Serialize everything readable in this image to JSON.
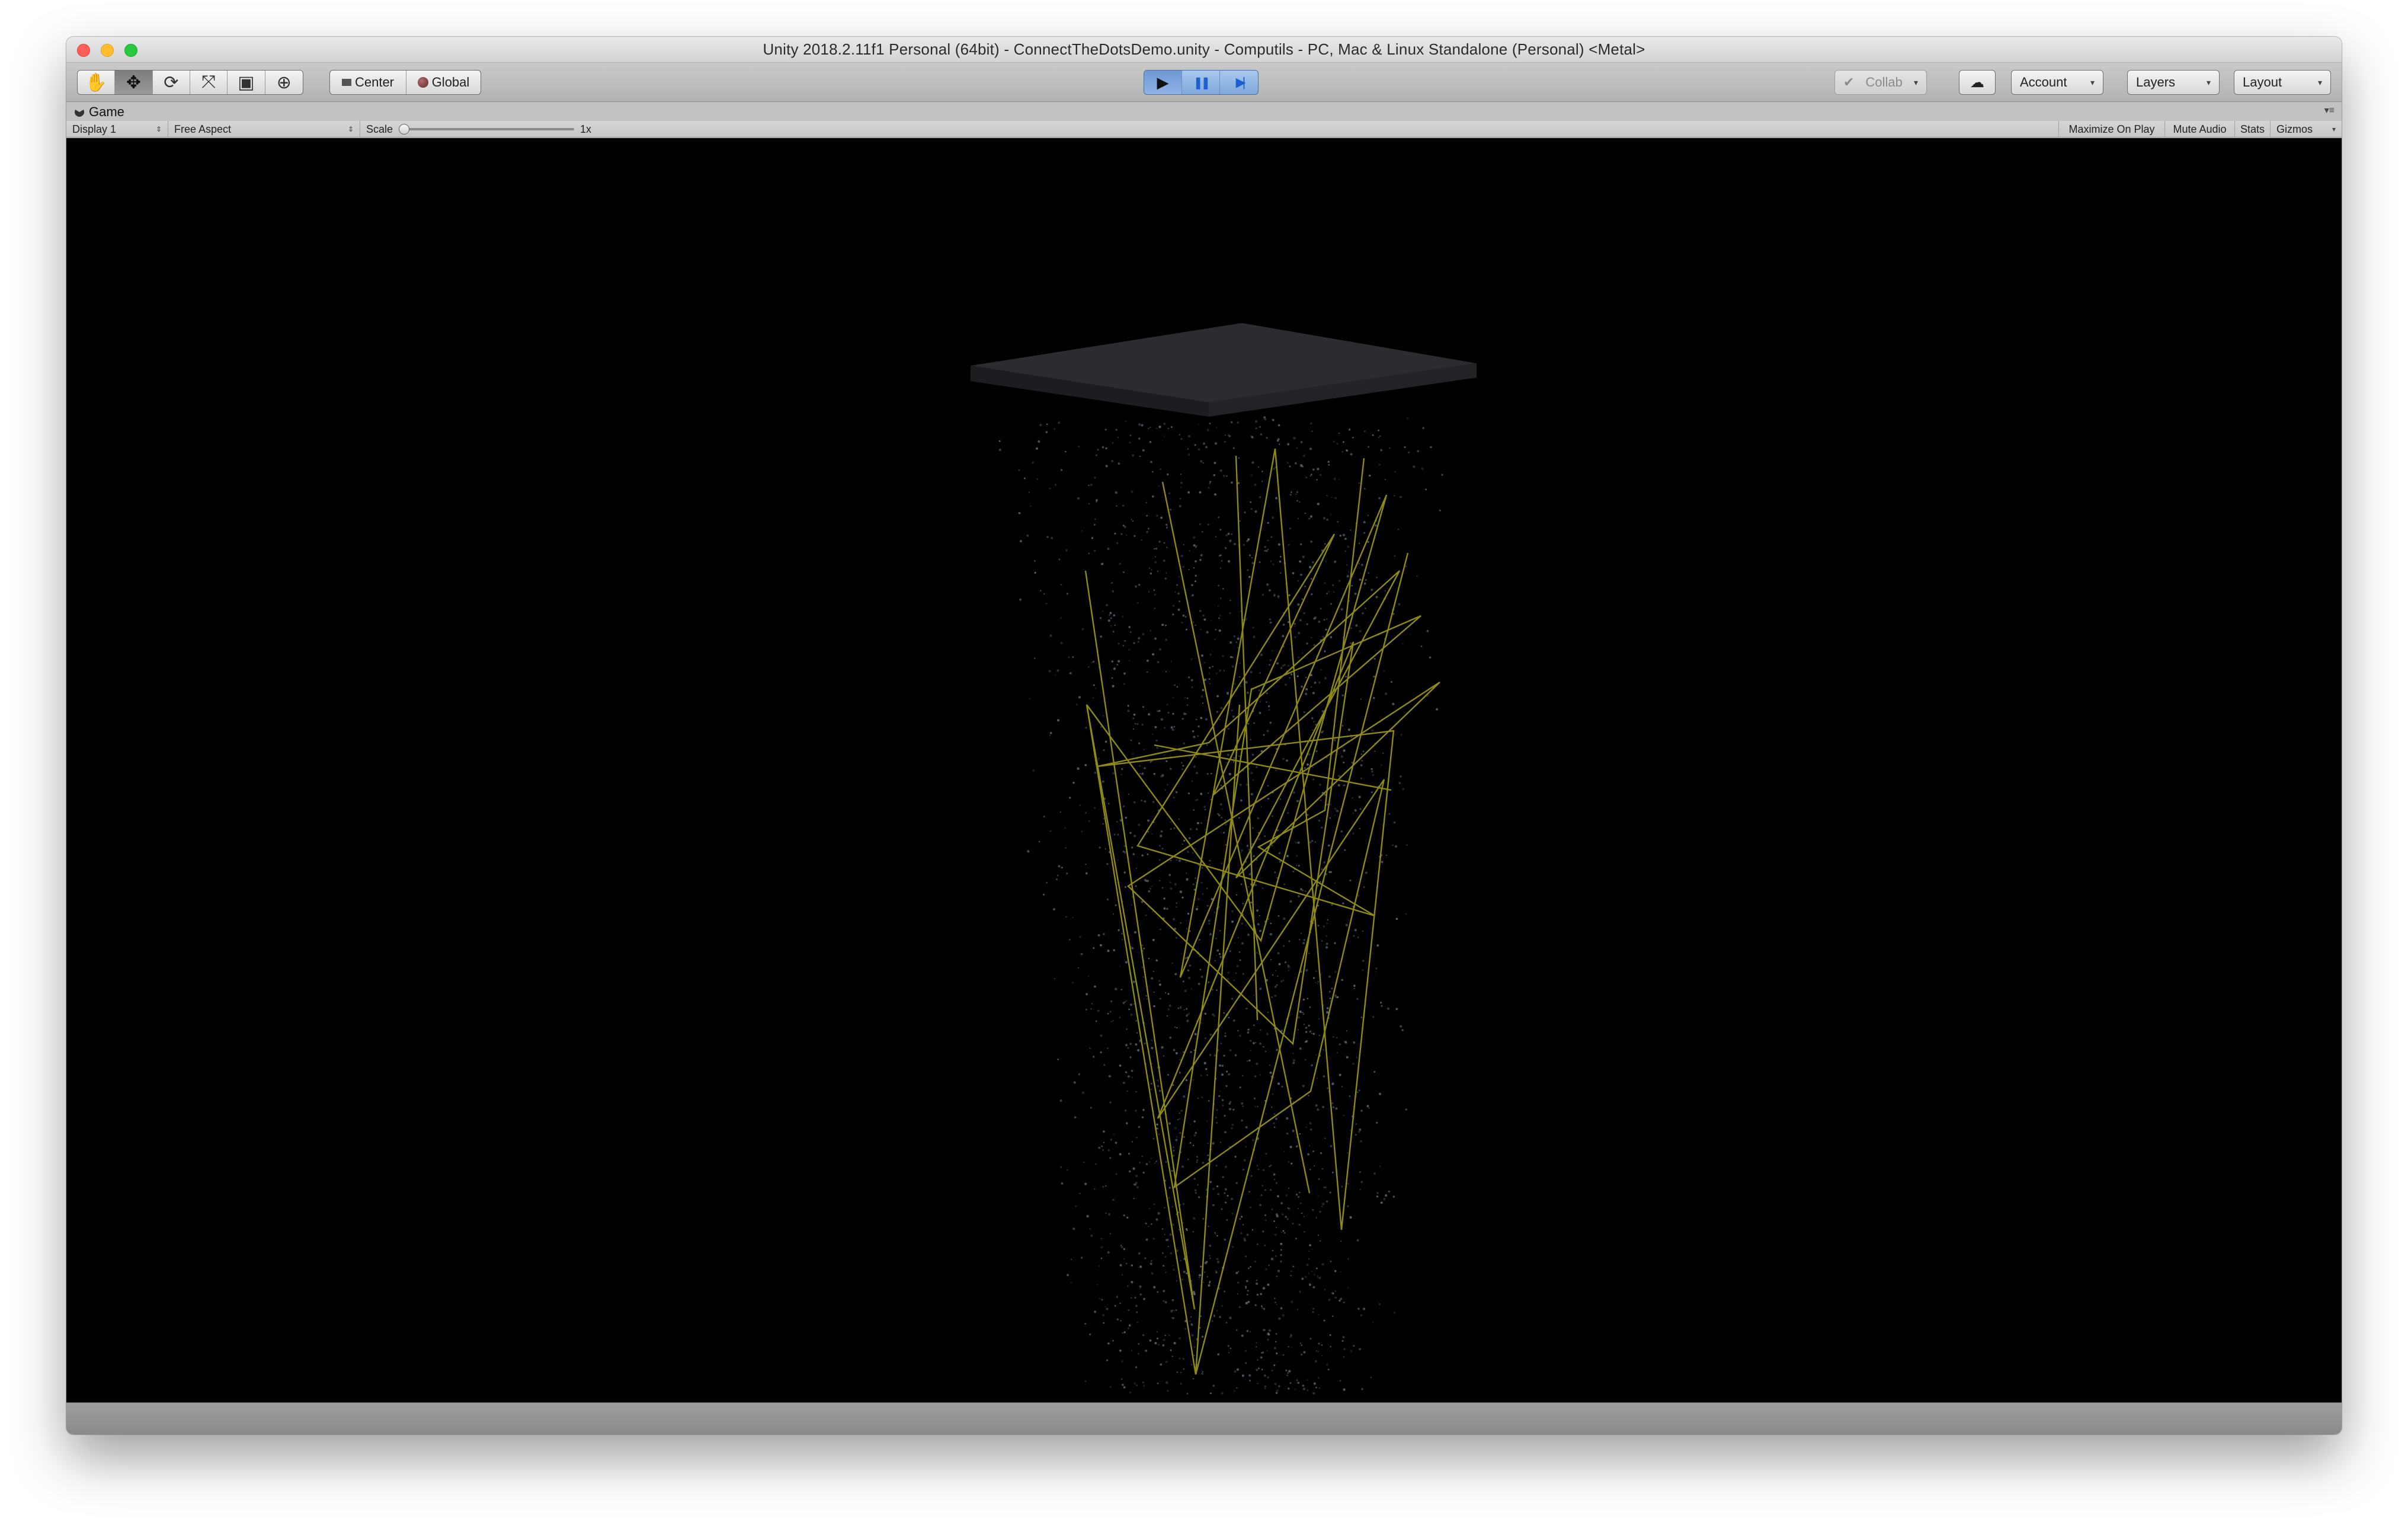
{
  "window": {
    "title": "Unity 2018.2.11f1 Personal (64bit) - ConnectTheDotsDemo.unity - Computils - PC, Mac & Linux Standalone (Personal) <Metal>"
  },
  "toolbar": {
    "tools": [
      {
        "name": "hand-tool",
        "glyph": "✋"
      },
      {
        "name": "move-tool",
        "glyph": "✥"
      },
      {
        "name": "rotate-tool",
        "glyph": "⟳"
      },
      {
        "name": "scale-tool",
        "glyph": "⤧"
      },
      {
        "name": "rect-tool",
        "glyph": "▣"
      },
      {
        "name": "transform-tool",
        "glyph": "⊕"
      }
    ],
    "active_tool": "move-tool",
    "pivot_label": "Center",
    "rotation_label": "Global",
    "play_glyph": "▶",
    "pause_glyph": "❚❚",
    "step_glyph": "▶|",
    "collab_label": "Collab",
    "account_label": "Account",
    "layers_label": "Layers",
    "layout_label": "Layout"
  },
  "game_panel": {
    "tab_label": "Game",
    "display_label": "Display 1",
    "aspect_label": "Free Aspect",
    "scale_label": "Scale",
    "scale_value": "1x",
    "maximize_label": "Maximize On Play",
    "mute_label": "Mute Audio",
    "stats_label": "Stats",
    "gizmos_label": "Gizmos"
  },
  "scene_colors": {
    "background": "#000000",
    "platform": "#2b2c30",
    "lines": "#8f8a16",
    "dots": "#6f7a88"
  }
}
